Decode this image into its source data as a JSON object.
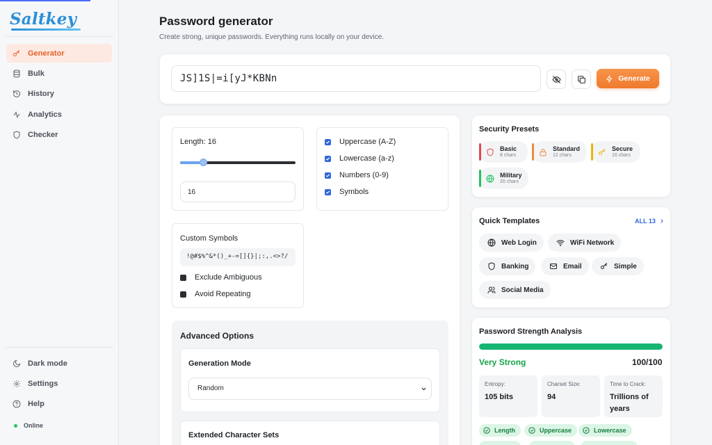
{
  "app": {
    "logo_text": "Saltkey"
  },
  "sidebar": {
    "items": [
      {
        "label": "Generator",
        "icon": "key-icon",
        "active": true
      },
      {
        "label": "Bulk",
        "icon": "database-icon"
      },
      {
        "label": "History",
        "icon": "history-icon"
      },
      {
        "label": "Analytics",
        "icon": "activity-icon"
      },
      {
        "label": "Checker",
        "icon": "shield-icon"
      }
    ],
    "bottom": [
      {
        "label": "Dark mode",
        "icon": "moon-icon"
      },
      {
        "label": "Settings",
        "icon": "gear-icon"
      },
      {
        "label": "Help",
        "icon": "help-icon"
      }
    ],
    "status": "Online"
  },
  "header": {
    "title": "Password generator",
    "subtitle": "Create strong, unique passwords. Everything runs locally on your device."
  },
  "password": {
    "value": "JS]1S|=i[yJ*KBNn",
    "generate_label": "Generate"
  },
  "options": {
    "length_label": "Length: 16",
    "length_value": "16",
    "length": 16,
    "length_min": 4,
    "length_max": 64,
    "charsets": [
      {
        "label": "Uppercase (A-Z)",
        "checked": true
      },
      {
        "label": "Lowercase (a-z)",
        "checked": true
      },
      {
        "label": "Numbers (0-9)",
        "checked": true
      },
      {
        "label": "Symbols",
        "checked": true
      }
    ],
    "custom_symbols_label": "Custom Symbols",
    "custom_symbols_value": "!@#$%^&*()_+-=[]{}|;:,.<>?/",
    "exclude_ambiguous_label": "Exclude Ambiguous",
    "avoid_repeating_label": "Avoid Repeating"
  },
  "advanced": {
    "title": "Advanced Options",
    "mode_label": "Generation Mode",
    "mode_value": "Random",
    "extended_label": "Extended Character Sets"
  },
  "presets": {
    "title": "Security Presets",
    "items": [
      {
        "name": "Basic",
        "desc": "8 chars",
        "color": "#e5484d",
        "icon": "shield-icon"
      },
      {
        "name": "Standard",
        "desc": "12 chars",
        "color": "#f08a3a",
        "icon": "lock-icon"
      },
      {
        "name": "Secure",
        "desc": "16 chars",
        "color": "#eab308",
        "icon": "key-icon"
      },
      {
        "name": "Military",
        "desc": "20 chars",
        "color": "#22c55e",
        "icon": "globe-icon"
      }
    ]
  },
  "templates": {
    "title": "Quick Templates",
    "all_label": "ALL 13",
    "items": [
      {
        "label": "Web Login",
        "icon": "globe-icon"
      },
      {
        "label": "WiFi Network",
        "icon": "wifi-icon"
      },
      {
        "label": "Banking",
        "icon": "shield-icon"
      },
      {
        "label": "Email",
        "icon": "mail-icon"
      },
      {
        "label": "Simple",
        "icon": "key-icon"
      },
      {
        "label": "Social Media",
        "icon": "users-icon"
      }
    ]
  },
  "strength": {
    "title": "Password Strength Analysis",
    "rating": "Very Strong",
    "score_text": "100/100",
    "score": 100,
    "stats": [
      {
        "label": "Entropy:",
        "value": "105 bits"
      },
      {
        "label": "Charset Size:",
        "value": "94"
      },
      {
        "label": "Time to Crack:",
        "value": "Trillions of years"
      }
    ],
    "checks": [
      "Length",
      "Uppercase",
      "Lowercase"
    ],
    "colors": {
      "good": "#16a34a",
      "bar": "#17b573"
    }
  },
  "colors": {
    "accent": "#e4622e",
    "primary": "#2f67d8"
  }
}
